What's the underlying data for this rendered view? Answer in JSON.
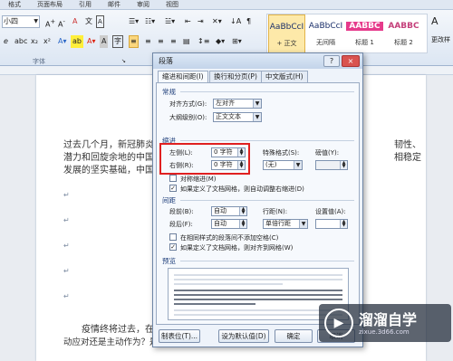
{
  "ribbon_tabs": [
    "格式",
    "页面布局",
    "引用",
    "邮件",
    "审阅",
    "视图"
  ],
  "font_size": "小四",
  "font_group_label": "字体",
  "styles": [
    {
      "preview": "AaBbCcI",
      "name": "+ 正文"
    },
    {
      "preview": "AaBbCcI",
      "name": "无间隔"
    },
    {
      "preview": "AABBC",
      "name": "标题 1"
    },
    {
      "preview": "AABBC",
      "name": "标题 2"
    }
  ],
  "change_styles": "更改样",
  "document": {
    "line1": "过去几个月，新冠肺炎",
    "line2": "潜力和回旋余地的中国",
    "line3": "发展的坚实基础，中国",
    "line1_right": "韧性、",
    "line2_right": "相稳定",
    "bottom1": "疫情终将过去，在",
    "bottom2": "动应对还是主动作为？是您视近寻还是至前行？是消极等待形势好转还是积"
  },
  "dialog": {
    "title": "段落",
    "help": "?",
    "close": "×",
    "tabs": [
      "缩进和间距(I)",
      "换行和分页(P)",
      "中文版式(H)"
    ],
    "general": {
      "heading": "常规",
      "align_label": "对齐方式(G):",
      "align_value": "左对齐",
      "outline_label": "大纲级别(O):",
      "outline_value": "正文文本"
    },
    "indent": {
      "heading": "缩进",
      "left_label": "左侧(L):",
      "left_value": "0 字符",
      "right_label": "右侧(R):",
      "right_value": "0 字符",
      "special_label": "特殊格式(S):",
      "special_value": "(无)",
      "by_label": "磅值(Y):",
      "mirror": "对称缩进(M)",
      "auto_adjust": "如果定义了文档网格，则自动调整右缩进(D)"
    },
    "spacing": {
      "heading": "间距",
      "before_label": "段前(B):",
      "before_value": "自动",
      "after_label": "段后(F):",
      "after_value": "自动",
      "line_label": "行距(N):",
      "line_value": "单倍行距",
      "at_label": "设置值(A):",
      "no_space": "在相同样式的段落间不添加空格(C)",
      "snap_grid": "如果定义了文档网格，则对齐到网格(W)"
    },
    "preview_heading": "预览",
    "buttons": {
      "tabs": "制表位(T)...",
      "default": "设为默认值(D)",
      "ok": "确定",
      "cancel": "取消"
    }
  },
  "watermark": {
    "brand": "溜溜自学",
    "url": "zixue.3d66.com"
  },
  "colors": {
    "highlight": "#e02020",
    "accent": "#1e3e7a"
  }
}
